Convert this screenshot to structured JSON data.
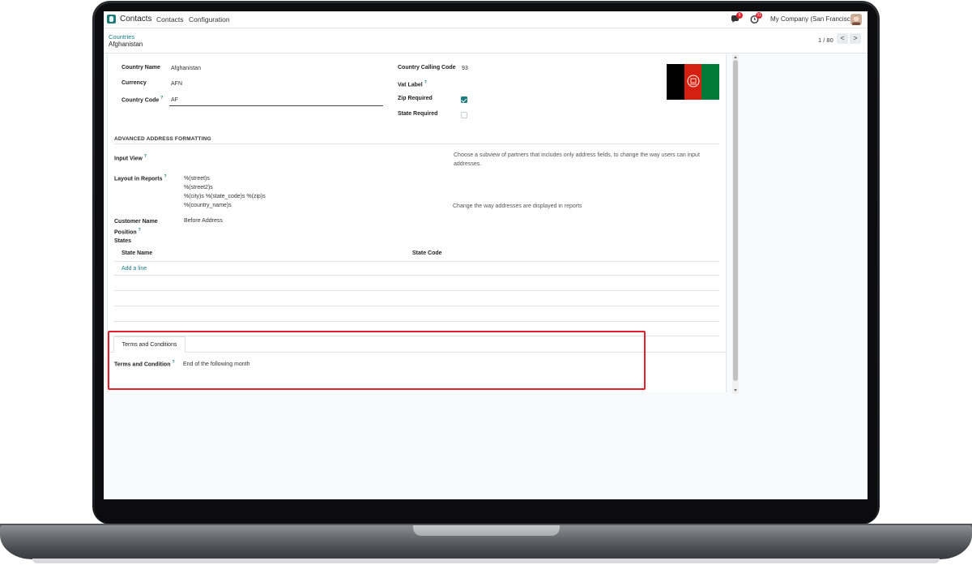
{
  "navbar": {
    "app_name": "Contacts",
    "menu": [
      "Contacts",
      "Configuration"
    ],
    "chat_badge": "6",
    "activity_badge": "31",
    "company": "My Company (San Francisco)"
  },
  "breadcrumb": {
    "parent": "Countries",
    "current": "Afghanistan"
  },
  "pager": {
    "value": "1 / 80",
    "prev": "<",
    "next": ">"
  },
  "form": {
    "country_name_label": "Country Name",
    "country_name": "Afghanistan",
    "currency_label": "Currency",
    "currency": "AFN",
    "country_code_label": "Country Code",
    "country_code": "AF",
    "calling_code_label": "Country Calling Code",
    "calling_code": "93",
    "vat_label_label": "Vat Label",
    "zip_required_label": "Zip Required",
    "zip_required": true,
    "state_required_label": "State Required",
    "state_required": false,
    "help_mark": "?"
  },
  "advanced": {
    "title": "ADVANCED ADDRESS FORMATTING",
    "input_view_label": "Input View",
    "input_view_help_1": "Choose a subview of partners that includes only address fields, to change the way users can input",
    "input_view_help_2": "addresses.",
    "layout_label": "Layout in Reports",
    "layout_lines": [
      "%(street)s",
      "%(street2)s",
      "%(city)s %(state_code)s %(zip)s",
      "%(country_name)s"
    ],
    "layout_help": "Change the way addresses are displayed in reports",
    "customer_name_label_1": "Customer Name",
    "customer_name_label_2": "Position",
    "customer_name_value": "Before Address",
    "states_label": "States",
    "states_columns": [
      "State Name",
      "State Code"
    ],
    "add_line": "Add a line"
  },
  "terms": {
    "tab_label": "Terms and Conditions",
    "field_label": "Terms and Condition",
    "field_value": "End of the following month"
  },
  "colors": {
    "accent": "#1a7a80",
    "highlight": "#e0202c",
    "badge": "#e2232e"
  }
}
